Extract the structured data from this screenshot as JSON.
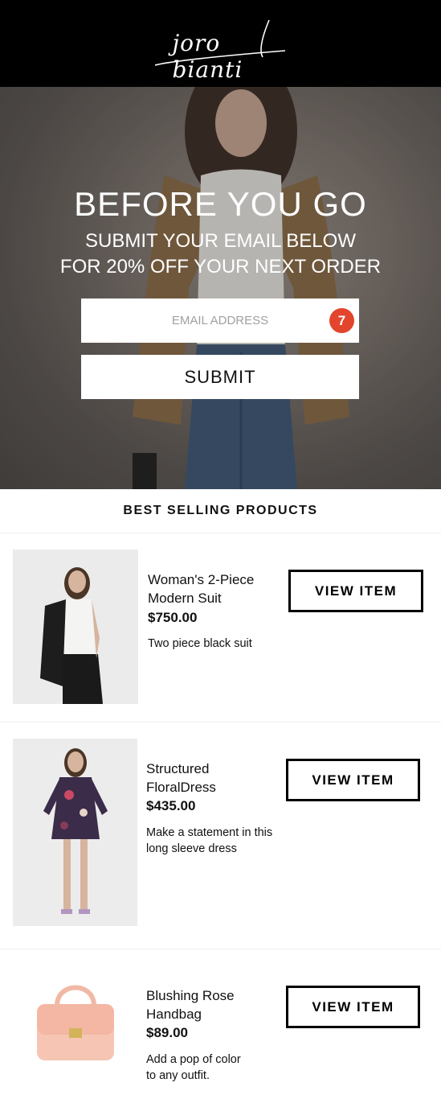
{
  "header": {
    "brand": "joro bianti"
  },
  "hero": {
    "title": "BEFORE YOU GO",
    "subtitle_line1": "SUBMIT YOUR EMAIL BELOW",
    "subtitle_line2": "FOR 20% OFF YOUR NEXT ORDER",
    "email_placeholder": "EMAIL ADDRESS",
    "badge_count": "7",
    "submit_label": "SUBMIT"
  },
  "section": {
    "title": "BEST SELLING PRODUCTS"
  },
  "products": [
    {
      "name_line1": "Woman's 2-Piece",
      "name_line2": "Modern Suit",
      "price": "$750.00",
      "desc_line1": "Two piece black suit",
      "desc_line2": "",
      "button": "VIEW ITEM"
    },
    {
      "name_line1": "Structured",
      "name_line2": "FloralDress",
      "price": "$435.00",
      "desc_line1": "Make a statement in this",
      "desc_line2": "long sleeve dress",
      "button": "VIEW ITEM"
    },
    {
      "name_line1": "Blushing Rose",
      "name_line2": "Handbag",
      "price": "$89.00",
      "desc_line1": "Add a pop of color",
      "desc_line2": "to any outfit.",
      "button": "VIEW ITEM"
    }
  ],
  "colors": {
    "header_bg": "#000000",
    "badge": "#e2452c",
    "text": "#111111"
  }
}
